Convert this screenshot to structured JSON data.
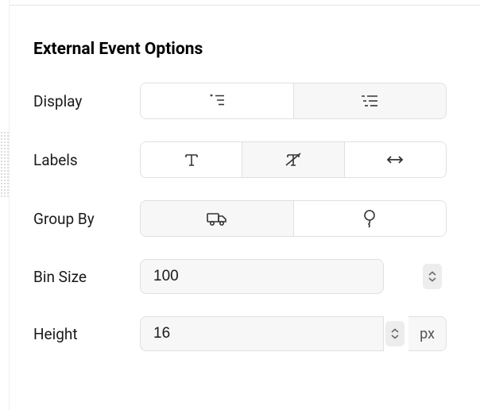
{
  "section": {
    "title": "External Event Options"
  },
  "rows": {
    "display": {
      "label": "Display"
    },
    "labels": {
      "label": "Labels"
    },
    "groupBy": {
      "label": "Group By"
    },
    "binSize": {
      "label": "Bin Size",
      "value": "100"
    },
    "height": {
      "label": "Height",
      "value": "16",
      "unit": "px"
    }
  }
}
